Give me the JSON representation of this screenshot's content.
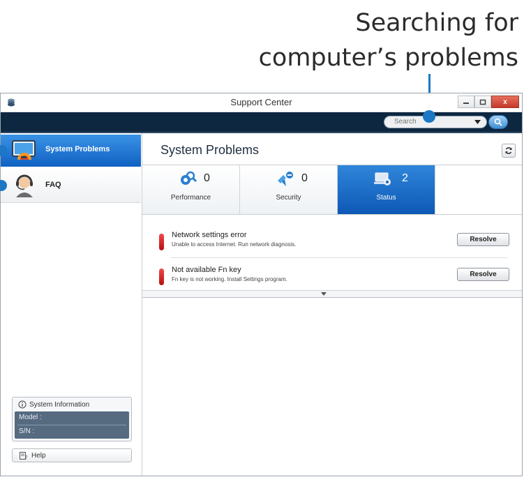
{
  "callout": {
    "line1": "Searching for",
    "line2": "computer’s problems"
  },
  "window": {
    "title": "Support Center",
    "controls": [
      "minimize",
      "maximize",
      "close"
    ],
    "close_label": "x"
  },
  "search": {
    "placeholder": "Search",
    "dropdown_icon": "chevron-down-icon",
    "button_icon": "search-icon"
  },
  "sidebar": {
    "items": [
      {
        "label": "System Problems",
        "icon": "monitor-warning-icon",
        "active": true
      },
      {
        "label": "FAQ",
        "icon": "headset-agent-icon",
        "active": false
      }
    ],
    "system_info": {
      "title": "System Information",
      "model_label": "Model :",
      "sn_label": "S/N :"
    },
    "help_label": "Help"
  },
  "main": {
    "title": "System Problems",
    "tabs": [
      {
        "label": "Performance",
        "count": "0",
        "icon": "gear-magnifier-icon",
        "selected": false
      },
      {
        "label": "Security",
        "count": "0",
        "icon": "shield-minus-icon",
        "selected": false
      },
      {
        "label": "Status",
        "count": "2",
        "icon": "laptop-gear-icon",
        "selected": true
      }
    ],
    "problems": [
      {
        "title": "Network settings error",
        "description": "Unable to access Internet. Run network diagnosis.",
        "action": "Resolve"
      },
      {
        "title": "Not available Fn key",
        "description": "Fn key is not working. Install Settings program.",
        "action": "Resolve"
      }
    ]
  },
  "colors": {
    "accent": "#1c78c4",
    "toolbar": "#0e2741",
    "error": "#d42020"
  }
}
